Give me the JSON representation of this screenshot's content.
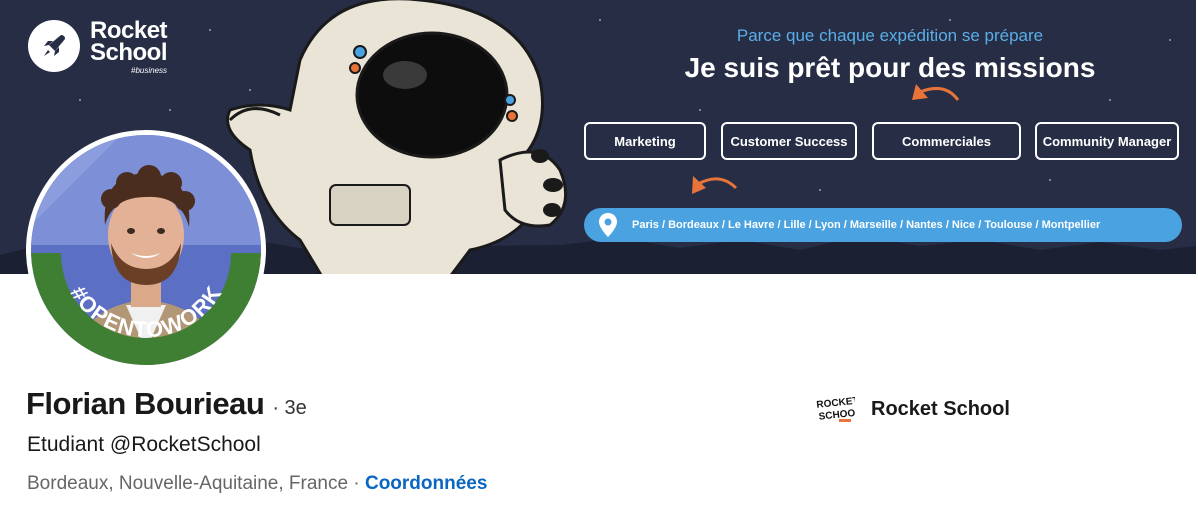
{
  "banner": {
    "logo_line1": "Rocket",
    "logo_line2": "School",
    "logo_sub": "#business",
    "tagline": "Parce que chaque expédition se prépare",
    "headline": "Je suis prêt pour des missions",
    "roles": [
      "Marketing",
      "Customer Success",
      "Commerciales",
      "Community Manager"
    ],
    "cities": "Paris / Bordeaux / Le Havre / Lille / Lyon / Marseille / Nantes / Nice / Toulouse / Montpellier",
    "colors": {
      "background": "#262d45",
      "tagline": "#5aaee8",
      "cities_pill": "#4aa3e0",
      "arrow": "#e8743a"
    }
  },
  "profile": {
    "opentowork_label": "#OPENTOWORK",
    "name": "Florian Bourieau",
    "degree": "· 3e",
    "headline": "Etudiant @RocketSchool",
    "location": "Bordeaux, Nouvelle-Aquitaine, France",
    "separator": " · ",
    "contact_link": "Coordonnées",
    "company_logo_text": "ROCKET SCHOOL",
    "company_name": "Rocket School",
    "colors": {
      "opentowork_ring": "#3f7f34",
      "link": "#0a66c2"
    }
  }
}
